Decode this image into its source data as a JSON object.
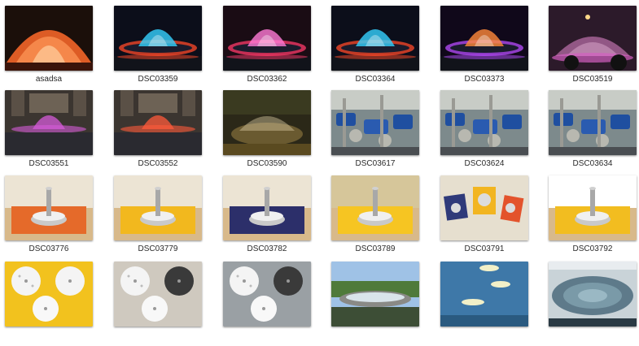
{
  "files": [
    {
      "name": "asadsa",
      "kind": "fountain-night-orange"
    },
    {
      "name": "DSC03359",
      "kind": "fountain-night-blue"
    },
    {
      "name": "DSC03362",
      "kind": "fountain-night-pink"
    },
    {
      "name": "DSC03364",
      "kind": "fountain-night-blue"
    },
    {
      "name": "DSC03373",
      "kind": "fountain-night-purple"
    },
    {
      "name": "DSC03519",
      "kind": "fountain-night-plaza"
    },
    {
      "name": "DSC03551",
      "kind": "fountain-building-pink"
    },
    {
      "name": "DSC03552",
      "kind": "fountain-building-red"
    },
    {
      "name": "DSC03590",
      "kind": "fountain-dusk"
    },
    {
      "name": "DSC03617",
      "kind": "pump-room"
    },
    {
      "name": "DSC03624",
      "kind": "pump-room"
    },
    {
      "name": "DSC03634",
      "kind": "pump-room"
    },
    {
      "name": "DSC03776",
      "kind": "nozzle-orange"
    },
    {
      "name": "DSC03779",
      "kind": "nozzle-yellow"
    },
    {
      "name": "DSC03782",
      "kind": "nozzle-navy"
    },
    {
      "name": "DSC03789",
      "kind": "nozzle-yellow-wide"
    },
    {
      "name": "DSC03791",
      "kind": "nozzle-parts"
    },
    {
      "name": "DSC03792",
      "kind": "nozzle-silver"
    },
    {
      "name": "",
      "kind": "plates-yellow"
    },
    {
      "name": "",
      "kind": "plates-white"
    },
    {
      "name": "",
      "kind": "plates-grey"
    },
    {
      "name": "",
      "kind": "pool-day"
    },
    {
      "name": "",
      "kind": "pool-blue"
    },
    {
      "name": "",
      "kind": "pool-jets"
    }
  ],
  "colors": {
    "caption": "#2a2a2a",
    "background": "#ffffff"
  }
}
